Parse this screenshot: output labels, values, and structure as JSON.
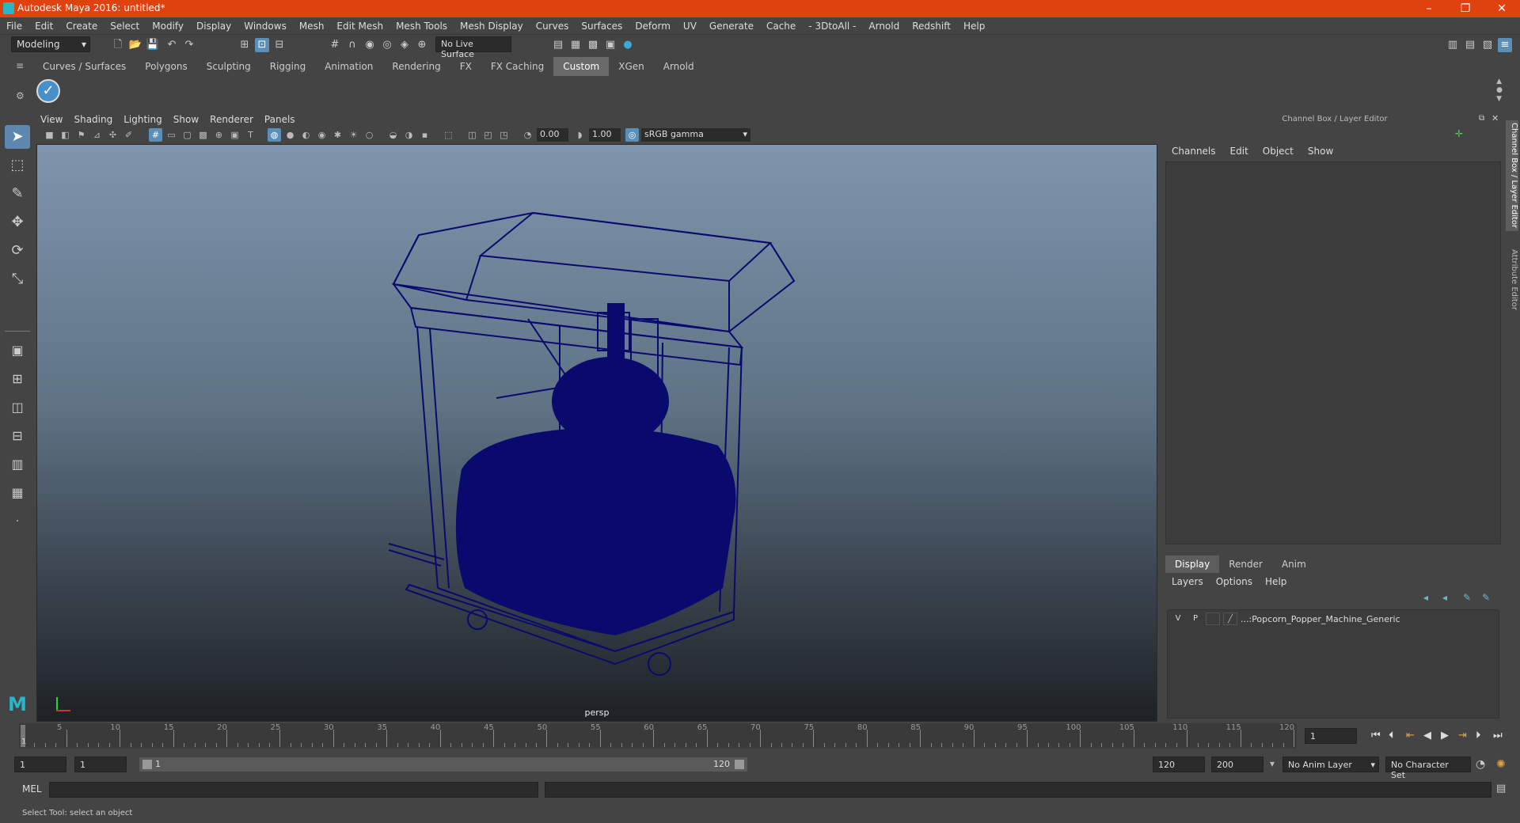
{
  "window": {
    "title": "Autodesk Maya 2016: untitled*"
  },
  "menubar": [
    "File",
    "Edit",
    "Create",
    "Select",
    "Modify",
    "Display",
    "Windows",
    "Mesh",
    "Edit Mesh",
    "Mesh Tools",
    "Mesh Display",
    "Curves",
    "Surfaces",
    "Deform",
    "UV",
    "Generate",
    "Cache",
    "- 3DtoAll -",
    "Arnold",
    "Redshift",
    "Help"
  ],
  "statusline": {
    "mode": "Modeling",
    "live_surface": "No Live Surface"
  },
  "shelf": {
    "tabs": [
      "Curves / Surfaces",
      "Polygons",
      "Sculpting",
      "Rigging",
      "Animation",
      "Rendering",
      "FX",
      "FX Caching",
      "Custom",
      "XGen",
      "Arnold"
    ],
    "selected": "Custom"
  },
  "viewport": {
    "menu": [
      "View",
      "Shading",
      "Lighting",
      "Show",
      "Renderer",
      "Panels"
    ],
    "exposure": "0.00",
    "gamma": "1.00",
    "colorspace": "sRGB gamma",
    "camera": "persp"
  },
  "channelbox": {
    "header": "Channel Box / Layer Editor",
    "menu": [
      "Channels",
      "Edit",
      "Object",
      "Show"
    ]
  },
  "sidetabs": {
    "channel": "Channel Box / Layer Editor",
    "attr": "Attribute Editor"
  },
  "layers": {
    "tabs": [
      "Display",
      "Render",
      "Anim"
    ],
    "selected": "Display",
    "menu": [
      "Layers",
      "Options",
      "Help"
    ],
    "rows": [
      {
        "v": "V",
        "p": "P",
        "name": "...:Popcorn_Popper_Machine_Generic"
      }
    ]
  },
  "timeline": {
    "ticks": [
      5,
      10,
      15,
      20,
      25,
      30,
      35,
      40,
      45,
      50,
      55,
      60,
      65,
      70,
      75,
      80,
      85,
      90,
      95,
      100,
      105,
      110,
      115,
      120
    ],
    "current": "1",
    "current_field": "1"
  },
  "range": {
    "start": "1",
    "playback_start": "1",
    "slider_start": "1",
    "slider_end": "120",
    "playback_end": "120",
    "end": "200",
    "anim_layer": "No Anim Layer",
    "char_set": "No Character Set"
  },
  "cmd": {
    "label": "MEL"
  },
  "help": {
    "text": "Select Tool: select an object"
  },
  "colors": {
    "titlebar": "#e0420f",
    "model": "#0a0a6e",
    "accent": "#5a8fb8"
  }
}
